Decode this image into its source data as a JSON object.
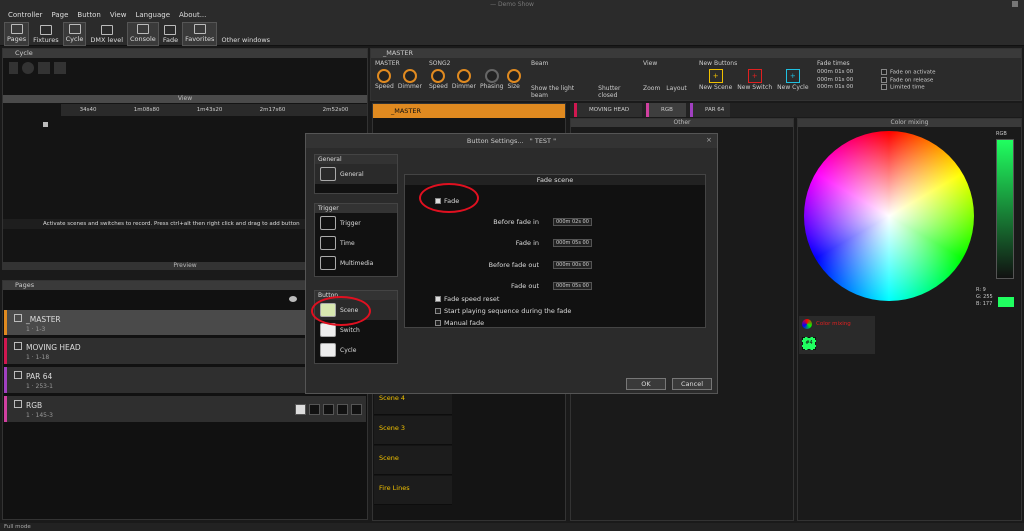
{
  "window": {
    "title": "— Demo Show"
  },
  "menu": [
    "Controller",
    "Page",
    "Button",
    "View",
    "Language",
    "About..."
  ],
  "toolbar": [
    "Pages",
    "Fixtures",
    "Cycle",
    "DMX level",
    "Console",
    "Fade",
    "Favorites",
    "Other windows"
  ],
  "cycle": {
    "title": "Cycle",
    "view_label": "View",
    "times": [
      "34s40",
      "1m08s80",
      "1m43s20",
      "2m17s60",
      "2m52s00"
    ],
    "hint": "Activate scenes and switches to record. Press ctrl+alt then right click and drag to add button",
    "preview_label": "Preview"
  },
  "pages": {
    "title": "Pages",
    "items": [
      {
        "name": "_MASTER",
        "sub": "1 · 1-3",
        "color": "#e08a20"
      },
      {
        "name": "MOVING HEAD",
        "sub": "1 · 1-18",
        "color": "#d01850"
      },
      {
        "name": "PAR 64",
        "sub": "1 · 253-1",
        "color": "#a040c0"
      },
      {
        "name": "RGB",
        "sub": "1 · 145-3",
        "color": "#d040a0"
      }
    ]
  },
  "master": {
    "title": "_MASTER",
    "groups": [
      {
        "label": "MASTER",
        "knobs": [
          "Speed",
          "Dimmer"
        ]
      },
      {
        "label": "SONG2",
        "knobs": [
          "Speed",
          "Dimmer",
          "Phasing",
          "Size"
        ]
      }
    ],
    "beam": {
      "label": "Beam",
      "items": [
        "Show the light beam",
        "Shutter closed"
      ]
    },
    "view": {
      "label": "View",
      "items": [
        "Zoom",
        "Layout"
      ]
    },
    "new_buttons": {
      "label": "New Buttons",
      "items": [
        "New Scene",
        "New Switch",
        "New Cycle"
      ]
    },
    "fade_times": {
      "label": "Fade times",
      "values": [
        "000m 01s 00",
        "000m 01s 00",
        "000m 01s 00"
      ],
      "options": [
        "Fade on activate",
        "Fade on release",
        "Limited time"
      ]
    }
  },
  "tabs": {
    "left": "_MASTER",
    "right": [
      "MOVING HEAD",
      "RGB",
      "PAR 64"
    ]
  },
  "scenes": [
    "Scene 4",
    "Scene 3",
    "Scene",
    "Fire Lines"
  ],
  "other_label": "Other",
  "color_mixing": {
    "label": "Color mixing",
    "rgb_label": "RGB",
    "r": "R: 9",
    "g": "G: 255",
    "b": "B: 177",
    "link": "Color mixing",
    "swatch": "#4"
  },
  "dialog": {
    "title": "Button Settings...",
    "quoted": "\" TEST \"",
    "general_h": "General",
    "general": "General",
    "trigger_h": "Trigger",
    "trigger": [
      "Trigger",
      "Time",
      "Multimedia"
    ],
    "button_h": "Button",
    "button": [
      "Scene",
      "Switch",
      "Cycle"
    ],
    "fade_scene": "Fade scene",
    "fade": "Fade",
    "rows": [
      {
        "label": "Before fade in",
        "value": "000m 02s 00"
      },
      {
        "label": "Fade in",
        "value": "000m 05s 00"
      },
      {
        "label": "Before fade out",
        "value": "000m 00s 00"
      },
      {
        "label": "Fade out",
        "value": "000m 05s 00"
      }
    ],
    "checks": [
      {
        "label": "Fade speed reset",
        "on": true
      },
      {
        "label": "Start playing sequence during the fade",
        "on": false
      },
      {
        "label": "Manual fade",
        "on": false
      }
    ],
    "ok": "OK",
    "cancel": "Cancel"
  },
  "status": "Full mode"
}
